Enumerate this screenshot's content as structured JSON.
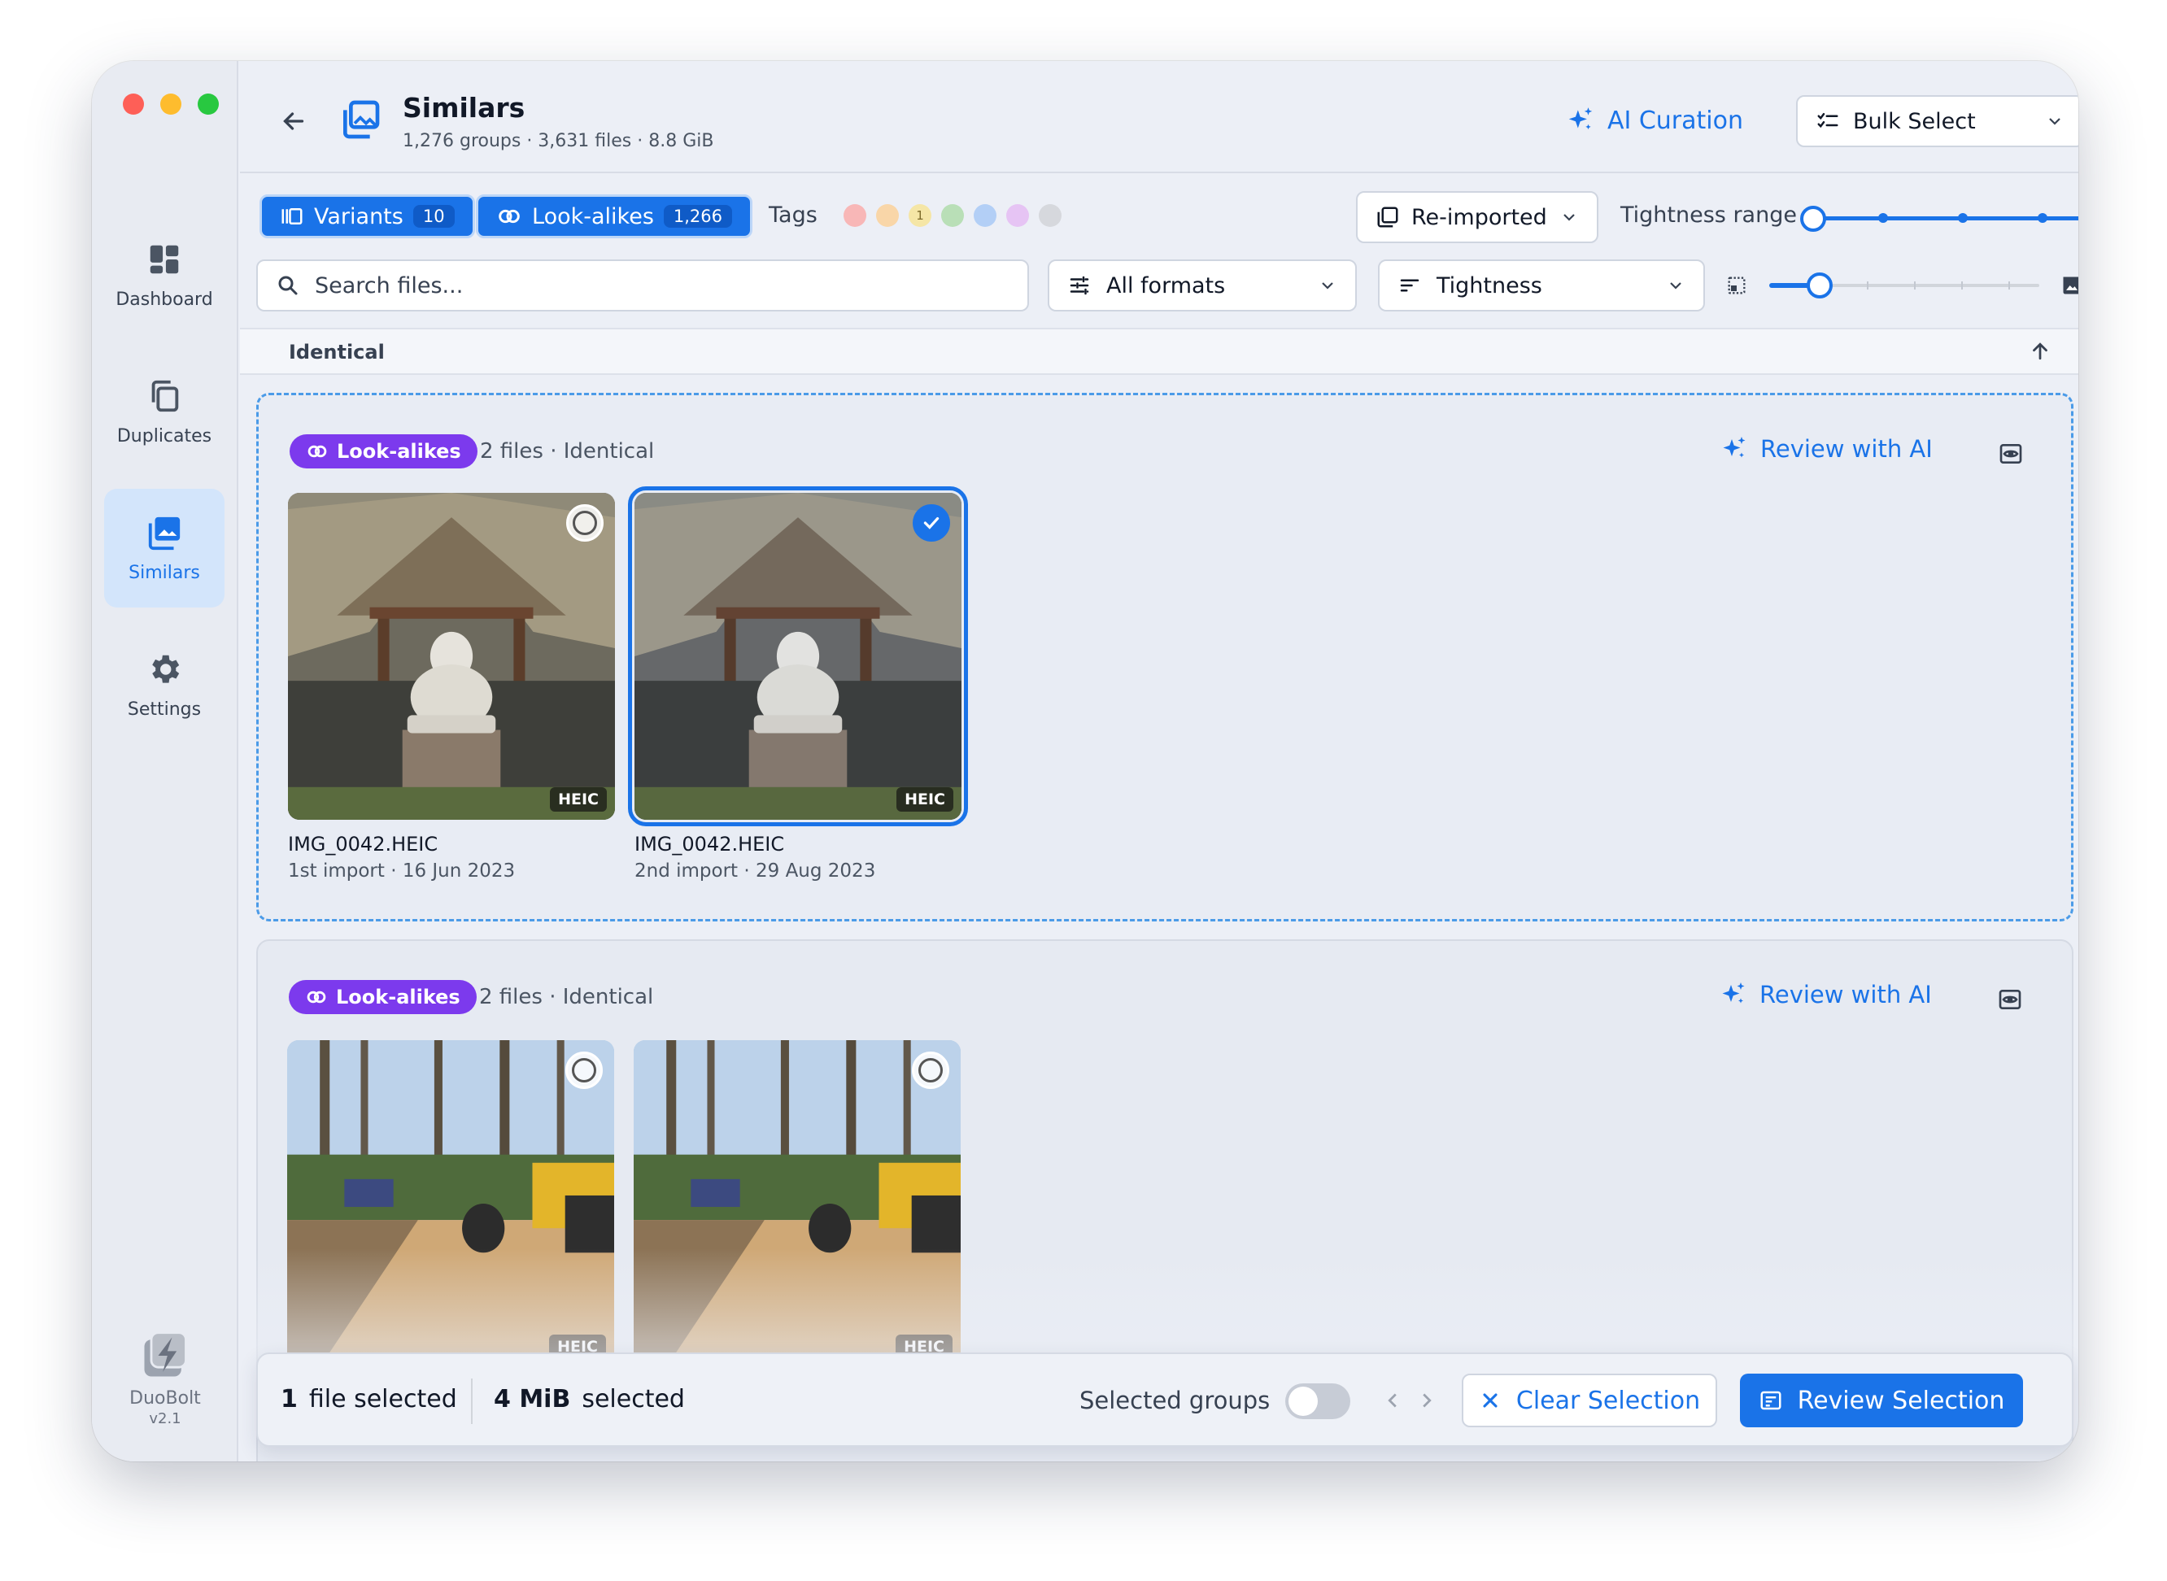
{
  "sidebar": {
    "items": [
      {
        "label": "Dashboard",
        "icon": "dashboard-icon"
      },
      {
        "label": "Duplicates",
        "icon": "copy-icon"
      },
      {
        "label": "Similars",
        "icon": "images-icon",
        "active": true
      },
      {
        "label": "Settings",
        "icon": "gear-icon"
      }
    ],
    "brand": {
      "name": "DuoBolt",
      "version": "v2.1"
    }
  },
  "header": {
    "title": "Similars",
    "subtitle": "1,276 groups · 3,631 files · 8.8 GiB",
    "ai_curation": "AI Curation",
    "bulk_select": "Bulk Select"
  },
  "filters": {
    "tabs": [
      {
        "label": "Variants",
        "count": "10"
      },
      {
        "label": "Look-alikes",
        "count": "1,266"
      }
    ],
    "tags_label": "Tags",
    "tag_colors": [
      "#f8b7b7",
      "#f9d6a8",
      "#f5e6a6",
      "#b9dfb7",
      "#b3cff6",
      "#e6c4f4",
      "#d6d8dd"
    ],
    "tag_badge": "1",
    "reimported": "Re-imported",
    "tightness_range_label": "Tightness range",
    "search_placeholder": "Search files...",
    "formats": "All formats",
    "sort": "Tightness"
  },
  "section": {
    "label": "Identical"
  },
  "groups": [
    {
      "pill": "Look-alikes",
      "meta": "2 files · Identical",
      "review": "Review with AI",
      "files": [
        {
          "name": "IMG_0042.HEIC",
          "info": "1st import · 16 Jun 2023",
          "badge": "HEIC",
          "selected": false
        },
        {
          "name": "IMG_0042.HEIC",
          "info": "2nd import · 29 Aug 2023",
          "badge": "HEIC",
          "selected": true
        }
      ]
    },
    {
      "pill": "Look-alikes",
      "meta": "2 files · Identical",
      "review": "Review with AI",
      "files": [
        {
          "badge": "HEIC",
          "selected": false
        },
        {
          "badge": "HEIC",
          "selected": false
        }
      ]
    }
  ],
  "bottom": {
    "file_count": "1",
    "file_label": "file selected",
    "size_value": "4 MiB",
    "size_label": "selected",
    "groups_label": "Selected groups",
    "clear": "Clear Selection",
    "review": "Review Selection"
  }
}
